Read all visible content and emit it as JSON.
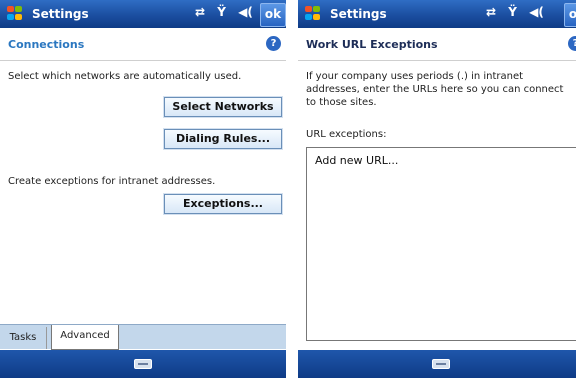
{
  "left_screen": {
    "app_title": "Settings",
    "ok_label": "ok",
    "header_title": "Connections",
    "help_label": "?",
    "description": "Select which networks are automatically used.",
    "select_networks_label": "Select Networks",
    "dialing_rules_label": "Dialing Rules...",
    "exceptions_description": "Create exceptions for intranet addresses.",
    "exceptions_label": "Exceptions...",
    "tabs": [
      {
        "label": "Tasks"
      },
      {
        "label": "Advanced"
      }
    ]
  },
  "right_screen": {
    "app_title": "Settings",
    "ok_label": "ok",
    "header_title": "Work URL Exceptions",
    "help_label": "?",
    "description": "If your company uses periods (.) in intranet addresses, enter the URLs here so you can connect to those sites.",
    "url_exceptions_label": "URL exceptions:",
    "add_url_item": "Add new URL..."
  },
  "status_icons": [
    "sync-icon",
    "signal-antenna-icon",
    "volume-icon"
  ],
  "colors": {
    "title_bar_blue": "#1b4ea0",
    "header_text_blue": "#2b77c0",
    "help_icon_blue": "#2c67c2",
    "tab_strip": "#c3d7eb"
  }
}
